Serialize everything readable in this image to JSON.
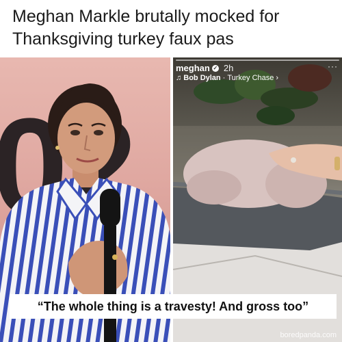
{
  "headline": {
    "line1": "Meghan Markle brutally mocked for",
    "line2": "Thanksgiving turkey faux pas"
  },
  "left_photo": {
    "background_digits": "02"
  },
  "story": {
    "username": "meghan",
    "verified_icon": "verified-check-icon",
    "time": "2h",
    "music_artist": "Bob Dylan",
    "music_separator": " · ",
    "music_track": "Turkey Chase",
    "chevron": "›",
    "more": "···"
  },
  "caption": "“The whole thing is a travesty! And gross too”",
  "watermark": "boredpanda.com",
  "colors": {
    "stripe_blue": "#3a4fb8",
    "backdrop_pink": "#e1aca5",
    "turkey": "#d8c3c0",
    "pan": "#54585d"
  }
}
